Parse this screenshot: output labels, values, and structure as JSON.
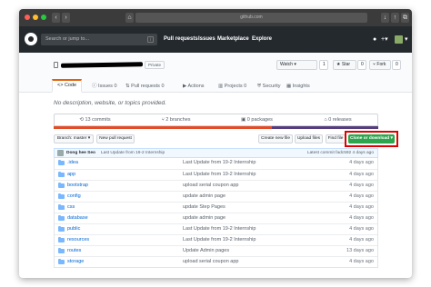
{
  "browser": {
    "url": "github.com",
    "back": "‹",
    "forward": "›",
    "home_icon": "home-icon",
    "tabs_icon": "tabs-icon"
  },
  "header": {
    "search_placeholder": "Search or jump to...",
    "search_key": "/",
    "nav": [
      "Pull requests",
      "Issues",
      "Marketplace",
      "Explore"
    ],
    "notifications_icon": "bell-icon",
    "plus": "+▾",
    "avatar_caret": "▾"
  },
  "repo": {
    "visibility": "Private",
    "watch_label": "Watch ▾",
    "watch_count": "1",
    "star_label": "★ Star",
    "star_count": "0",
    "fork_label": "Fork",
    "fork_count": "0"
  },
  "tabs": [
    {
      "label": "<> Code"
    },
    {
      "label": "Issues 0"
    },
    {
      "label": "Pull requests 0"
    },
    {
      "label": "Actions"
    },
    {
      "label": "Projects 0"
    },
    {
      "label": "Security"
    },
    {
      "label": "Insights"
    }
  ],
  "description": "No description, website, or topics provided.",
  "stats": [
    "13 commits",
    "2 branches",
    "0 packages",
    "0 releases"
  ],
  "toolbar": {
    "branch": "Branch: master ▾",
    "new_pr": "New pull request",
    "create_file": "Create new file",
    "upload": "Upload files",
    "find_file": "Find file",
    "clone": "Clone or download ▾"
  },
  "latest_commit": {
    "author": "Dong hee Seo",
    "message": "Last Update from 19-2 Internship",
    "info": "Latest commit fadc592 4 days ago"
  },
  "files": [
    {
      "name": ".idea",
      "message": "Last Update from 19-2 Internship",
      "age": "4 days ago"
    },
    {
      "name": "app",
      "message": "Last Update from 19-2 Internship",
      "age": "4 days ago"
    },
    {
      "name": "bootstrap",
      "message": "upload serial coupon app",
      "age": "4 days ago"
    },
    {
      "name": "config",
      "message": "update admin page",
      "age": "4 days ago"
    },
    {
      "name": "css",
      "message": "update Step Pages",
      "age": "4 days ago"
    },
    {
      "name": "database",
      "message": "update admin page",
      "age": "4 days ago"
    },
    {
      "name": "public",
      "message": "Last Update from 19-2 Internship",
      "age": "4 days ago"
    },
    {
      "name": "resources",
      "message": "Last Update from 19-2 Internship",
      "age": "4 days ago"
    },
    {
      "name": "routes",
      "message": "Update Admin pages",
      "age": "13 days ago"
    },
    {
      "name": "storage",
      "message": "upload serial coupon app",
      "age": "4 days ago"
    }
  ]
}
